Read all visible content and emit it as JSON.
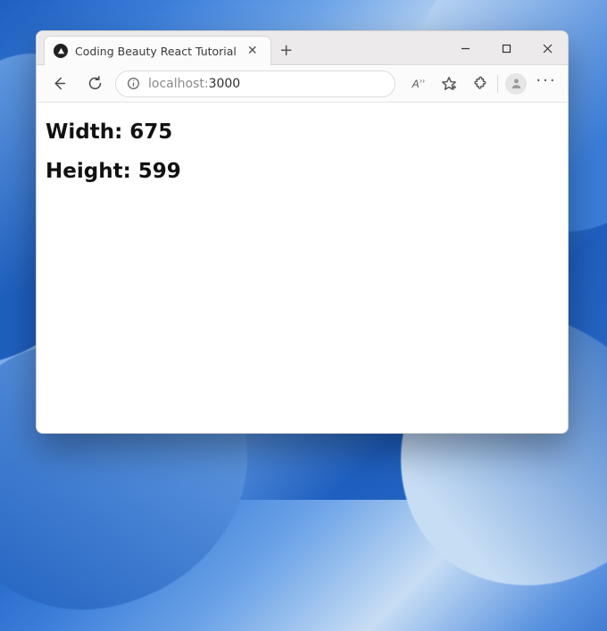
{
  "tab": {
    "title": "Coding Beauty React Tutorial"
  },
  "url": {
    "host": "localhost:",
    "port": "3000"
  },
  "page": {
    "width_label": "Width: ",
    "width_value": "675",
    "height_label": "Height: ",
    "height_value": "599"
  }
}
